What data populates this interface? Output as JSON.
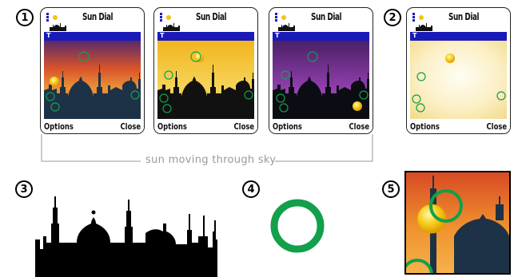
{
  "steps": [
    "1",
    "2",
    "3",
    "4",
    "5"
  ],
  "phones": [
    {
      "title": "Sun Dial",
      "options_label": "Options",
      "close_label": "Close",
      "bar_glyph": "T",
      "sky": "sunset"
    },
    {
      "title": "Sun Dial",
      "options_label": "Options",
      "close_label": "Close",
      "bar_glyph": "T",
      "sky": "golden"
    },
    {
      "title": "Sun Dial",
      "options_label": "Options",
      "close_label": "Close",
      "bar_glyph": "T",
      "sky": "purple"
    },
    {
      "title": "Sun Dial",
      "options_label": "Options",
      "close_label": "Close",
      "bar_glyph": "T",
      "sky": "plain"
    }
  ],
  "caption": "sun moving through sky",
  "colors": {
    "accent_bar": "#1a1ab8",
    "sun": "#f5c211",
    "ring": "#12a04a"
  }
}
